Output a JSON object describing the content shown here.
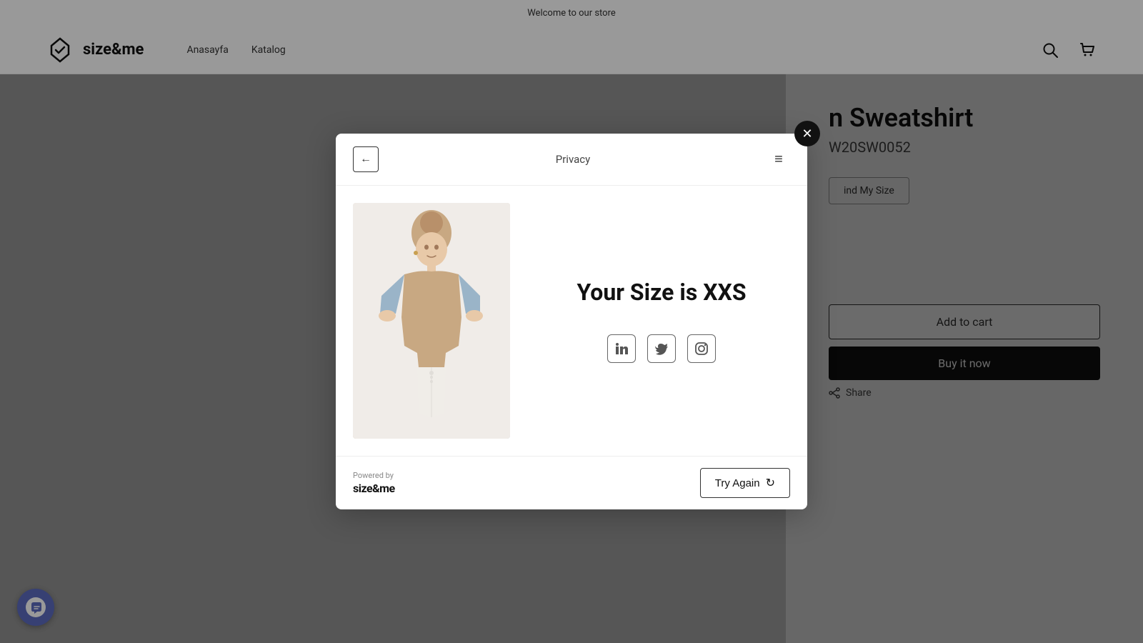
{
  "announcement": {
    "text": "Welcome to our store"
  },
  "header": {
    "logo_alt": "size&me logo",
    "logo_text": "size&me",
    "nav": [
      {
        "label": "Anasayfa",
        "id": "anasayfa"
      },
      {
        "label": "Katalog",
        "id": "katalog"
      }
    ],
    "search_label": "Search",
    "cart_label": "Cart"
  },
  "product": {
    "title": "n Sweatshirt",
    "sku": "W20SW0052",
    "find_size_label": "ind My Size",
    "add_to_cart_label": "Add to cart",
    "buy_now_label": "Buy it now",
    "share_label": "Share"
  },
  "modal": {
    "back_label": "←",
    "privacy_label": "Privacy",
    "menu_label": "≡",
    "close_label": "✕",
    "size_result": "Your Size is XXS",
    "social": {
      "linkedin_label": "LinkedIn",
      "twitter_label": "Twitter",
      "instagram_label": "Instagram"
    },
    "powered_by": "Powered by",
    "brand": "size&me",
    "try_again_label": "Try Again"
  },
  "shopify_bubble": {
    "label": "Shopify chat"
  }
}
